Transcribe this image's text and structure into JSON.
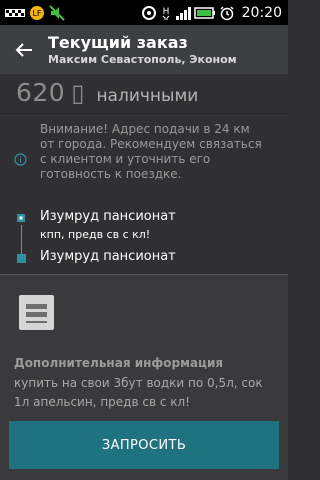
{
  "status_bar": {
    "time": "20:20",
    "icons": [
      "taxi-icon",
      "notification-icon",
      "mute-icon",
      "sync-icon",
      "network-h-icon",
      "signal-icon",
      "battery-icon",
      "alarm-icon"
    ]
  },
  "header": {
    "title": "Текущий заказ",
    "subtitle": "Максим Севастополь, Эконом"
  },
  "price": {
    "value": "620",
    "currency_glyph": "▯",
    "method": "наличными"
  },
  "warning": {
    "text": "Внимание! Адрес подачи в 24 км от города. Рекомендуем связаться с клиентом и уточнить его готовность к поездке."
  },
  "route": {
    "from": {
      "name": "Изумруд пансионат",
      "comment": "кпп, предв св с кл!"
    },
    "to": {
      "name": "Изумруд пансионат"
    }
  },
  "additional": {
    "title": "Дополнительная информация",
    "text": "купить на свои 3бут водки по 0,5л, сок 1л апельсин, предв св с кл!"
  },
  "action": {
    "request_label": "ЗАПРОСИТЬ"
  },
  "colors": {
    "accent": "#1f7380",
    "marker": "#2f8fa3"
  }
}
